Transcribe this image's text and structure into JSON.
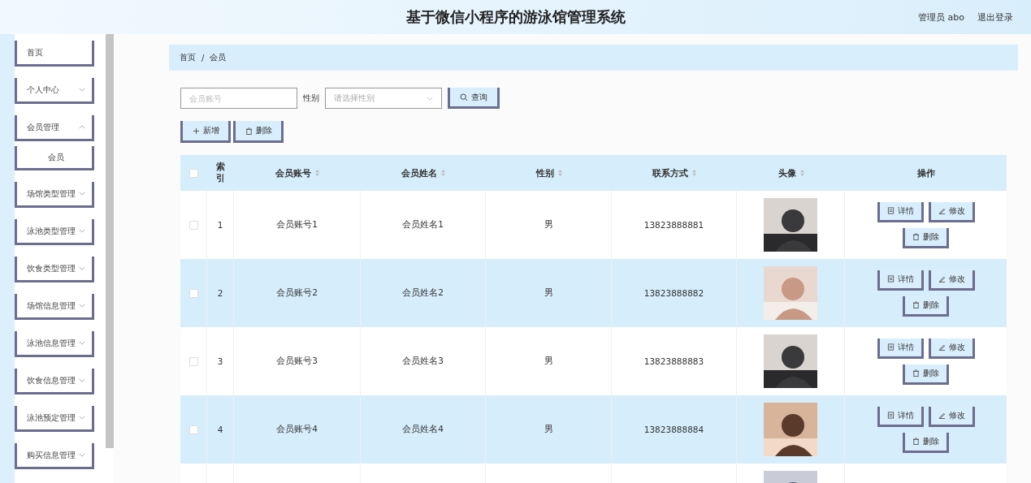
{
  "header": {
    "title": "基于微信小程序的游泳馆管理系统",
    "user": "管理员 abo",
    "logout": "退出登录"
  },
  "sidebar": {
    "items": [
      {
        "label": "首页",
        "kind": "link"
      },
      {
        "label": "个人中心",
        "kind": "submenu",
        "expanded": false
      },
      {
        "label": "会员管理",
        "kind": "submenu",
        "expanded": true,
        "children": [
          {
            "label": "会员"
          }
        ]
      },
      {
        "label": "场馆类型管理",
        "kind": "submenu",
        "expanded": false
      },
      {
        "label": "泳池类型管理",
        "kind": "submenu",
        "expanded": false
      },
      {
        "label": "饮食类型管理",
        "kind": "submenu",
        "expanded": false
      },
      {
        "label": "场馆信息管理",
        "kind": "submenu",
        "expanded": false
      },
      {
        "label": "泳池信息管理",
        "kind": "submenu",
        "expanded": false
      },
      {
        "label": "饮食信息管理",
        "kind": "submenu",
        "expanded": false
      },
      {
        "label": "泳池预定管理",
        "kind": "submenu",
        "expanded": false
      },
      {
        "label": "购买信息管理",
        "kind": "submenu",
        "expanded": false
      }
    ]
  },
  "breadcrumb": {
    "separator": "/",
    "items": [
      "首页",
      "会员"
    ]
  },
  "search": {
    "account_placeholder": "会员账号",
    "gender_label": "性别",
    "gender_placeholder": "请选择性别",
    "query_button": "查询"
  },
  "toolbar": {
    "add": "新增",
    "delete": "删除"
  },
  "table": {
    "header_checked": false,
    "columns": [
      {
        "label": "索引",
        "sortable": false
      },
      {
        "label": "会员账号",
        "sortable": true
      },
      {
        "label": "会员姓名",
        "sortable": true
      },
      {
        "label": "性别",
        "sortable": true
      },
      {
        "label": "联系方式",
        "sortable": true
      },
      {
        "label": "头像",
        "sortable": true
      },
      {
        "label": "操作",
        "sortable": false
      }
    ],
    "rows": [
      {
        "checked": false,
        "cells": [
          "1",
          "会员账号1",
          "会员姓名1",
          "男",
          "13823888881"
        ],
        "avatar": {
          "kind": "picture"
        },
        "actions": [
          "详情",
          "修改",
          "删除"
        ]
      },
      {
        "checked": false,
        "cells": [
          "2",
          "会员账号2",
          "会员姓名2",
          "男",
          "13823888882"
        ],
        "avatar": {
          "kind": "picture"
        },
        "actions": [
          "详情",
          "修改",
          "删除"
        ]
      },
      {
        "checked": false,
        "cells": [
          "3",
          "会员账号3",
          "会员姓名3",
          "男",
          "13823888883"
        ],
        "avatar": {
          "kind": "picture"
        },
        "actions": [
          "详情",
          "修改",
          "删除"
        ]
      },
      {
        "checked": false,
        "cells": [
          "4",
          "会员账号4",
          "会员姓名4",
          "男",
          "13823888884"
        ],
        "avatar": {
          "kind": "picture"
        },
        "actions": [
          "详情",
          "修改",
          "删除"
        ]
      },
      {
        "avatar": {
          "kind": "picture"
        }
      }
    ]
  }
}
